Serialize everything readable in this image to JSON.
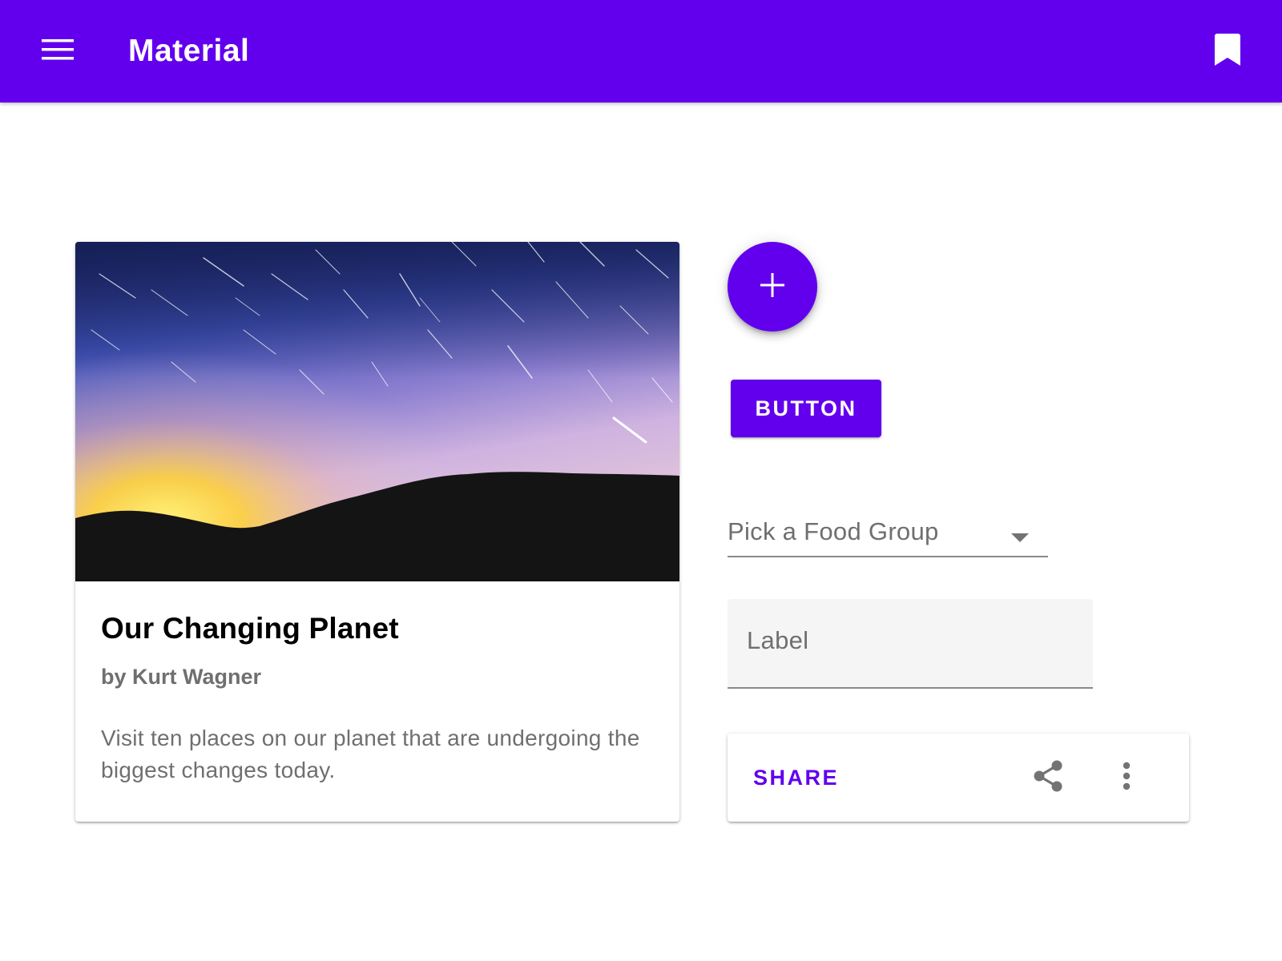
{
  "app_bar": {
    "title": "Material",
    "menu_icon": "menu-icon",
    "bookmark_icon": "bookmark-icon",
    "color": "#6200ee"
  },
  "card": {
    "image": "night-sky-star-trails-over-hills",
    "title": "Our Changing Planet",
    "subtitle": "by Kurt Wagner",
    "body": "Visit ten places on our planet that are undergoing the biggest changes today."
  },
  "fab": {
    "icon": "add-icon"
  },
  "button": {
    "label": "BUTTON"
  },
  "select": {
    "label": "Pick a Food Group",
    "icon": "arrow-drop-down-icon"
  },
  "text_field": {
    "label": "Label",
    "value": ""
  },
  "action_card": {
    "share_label": "SHARE",
    "share_icon": "share-icon",
    "more_icon": "more-vert-icon"
  },
  "colors": {
    "primary": "#6200ee",
    "on_primary": "#ffffff",
    "secondary_text": "#6f6f6f",
    "field_fill": "#f5f5f5"
  }
}
